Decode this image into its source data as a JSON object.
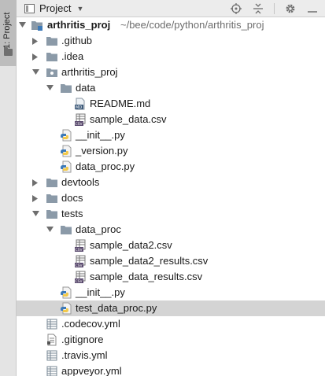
{
  "side_panel": {
    "tab_label": "1: Project"
  },
  "toolbar": {
    "title": "Project"
  },
  "icons": {
    "folder": "folder-icon",
    "module": "module-folder-icon",
    "markdown": "markdown-file-icon",
    "csv": "csv-file-icon",
    "python": "python-file-icon",
    "yaml": "yaml-file-icon",
    "text": "text-file-icon"
  },
  "colors": {
    "folder": "#8b9aa8",
    "python_blue": "#3d7ab8",
    "python_yellow": "#f2c94c",
    "selection": "#d4d4d4"
  },
  "tree": {
    "root": {
      "label": "arthritis_proj",
      "path": "~/bee/code/python/arthritis_proj"
    },
    "rows": [
      {
        "label": ".github"
      },
      {
        "label": ".idea"
      },
      {
        "label": "arthritis_proj"
      },
      {
        "label": "data"
      },
      {
        "label": "README.md"
      },
      {
        "label": "sample_data.csv"
      },
      {
        "label": "__init__.py"
      },
      {
        "label": "_version.py"
      },
      {
        "label": "data_proc.py"
      },
      {
        "label": "devtools"
      },
      {
        "label": "docs"
      },
      {
        "label": "tests"
      },
      {
        "label": "data_proc"
      },
      {
        "label": "sample_data2.csv"
      },
      {
        "label": "sample_data2_results.csv"
      },
      {
        "label": "sample_data_results.csv"
      },
      {
        "label": "__init__.py"
      },
      {
        "label": "test_data_proc.py"
      },
      {
        "label": ".codecov.yml"
      },
      {
        "label": ".gitignore"
      },
      {
        "label": ".travis.yml"
      },
      {
        "label": "appveyor.yml"
      }
    ]
  }
}
